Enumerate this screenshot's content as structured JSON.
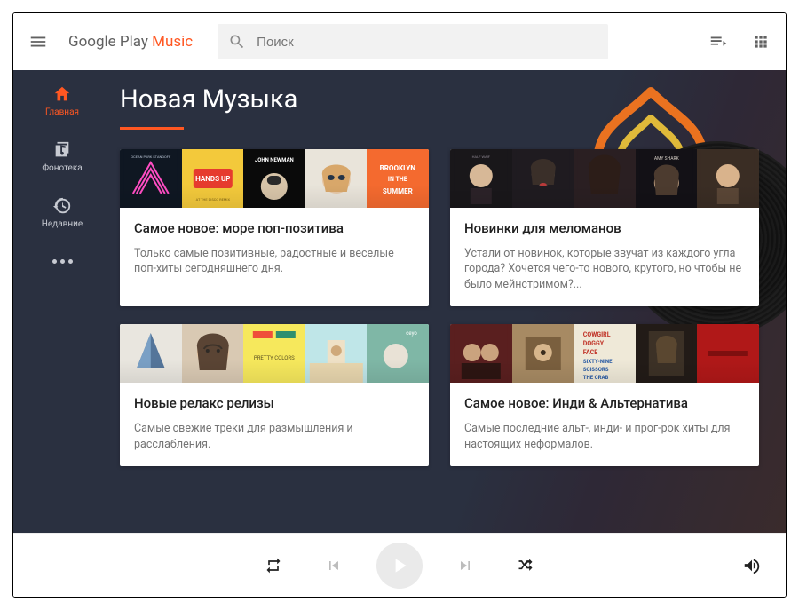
{
  "brand": {
    "part1": "Google Play ",
    "part2": "Music"
  },
  "search": {
    "placeholder": "Поиск"
  },
  "sidebar": {
    "items": [
      {
        "label": "Главная"
      },
      {
        "label": "Фонотека"
      },
      {
        "label": "Недавние"
      }
    ]
  },
  "page": {
    "title": "Новая Музыка"
  },
  "cards": [
    {
      "title": "Самое новое: море поп-позитива",
      "desc": "Только самые позитивные, радостные и веселые поп-хиты сегодняшнего дня."
    },
    {
      "title": "Новинки для меломанов",
      "desc": "Устали от новинок, которые звучат из каждого угла города? Хочется чего-то нового, крутого, но чтобы не было мейнстримом?..."
    },
    {
      "title": "Новые релакс релизы",
      "desc": "Самые свежие треки для размышления и расслабления."
    },
    {
      "title": "Самое новое: Инди & Альтернатива",
      "desc": "Самые последние альт-, инди- и прог-рок хиты для настоящих неформалов."
    }
  ],
  "colors": {
    "accent": "#ff5722"
  }
}
